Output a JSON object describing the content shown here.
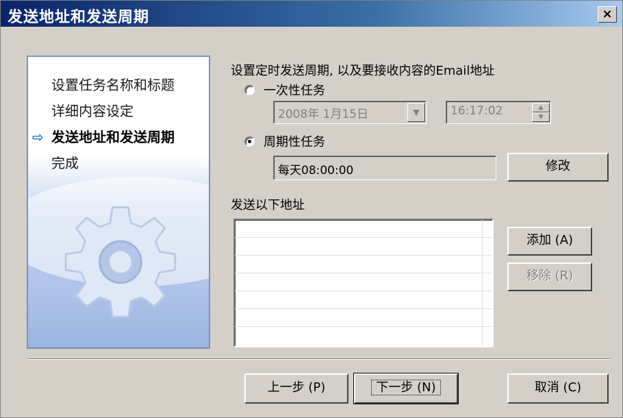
{
  "window": {
    "title": "发送地址和发送周期",
    "close_label": "×"
  },
  "wizard_steps": [
    {
      "label": "设置任务名称和标题",
      "active": false
    },
    {
      "label": "详细内容设定",
      "active": false
    },
    {
      "label": "发送地址和发送周期",
      "active": true
    },
    {
      "label": "完成",
      "active": false
    }
  ],
  "wizard_arrow": "⇨",
  "content": {
    "instruction": "设置定时发送周期, 以及要接收内容的Email地址",
    "once_label": "一次性任务",
    "once_date": "2008年 1月15日",
    "once_time": "16:17:02",
    "periodic_label": "周期性任务",
    "periodic_value": "每天08:00:00",
    "modify_label": "修改",
    "address_label": "发送以下地址",
    "add_label": "添加 (A)",
    "remove_label": "移除 (R)"
  },
  "footer": {
    "back_label": "上一步 (P)",
    "next_label": "下一步 (N)",
    "cancel_label": "取消 (C)"
  },
  "colors": {
    "title_start": "#0a246a",
    "title_end": "#a6caf0",
    "dialog_bg": "#d4d0c8",
    "step_arrow": "#2a78d8"
  },
  "icons": [
    "close-icon",
    "gear-icon",
    "arrow-right-icon",
    "dropdown-arrow-icon",
    "spin-up-icon",
    "spin-down-icon"
  ]
}
